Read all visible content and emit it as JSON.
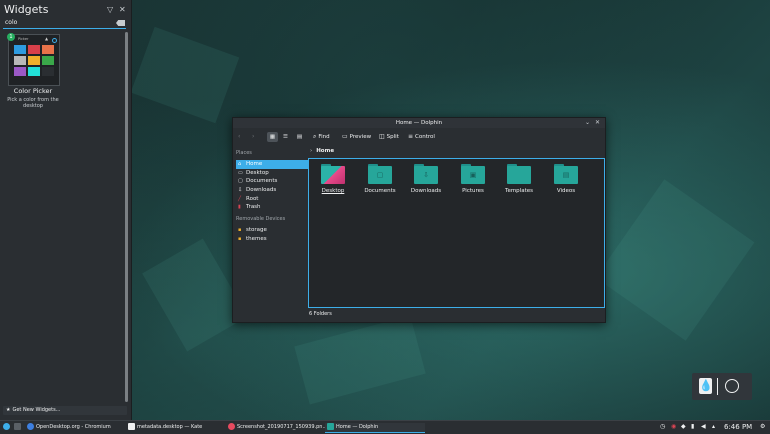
{
  "widgets": {
    "title": "Widgets",
    "search_value": "colo",
    "item": {
      "name": "Color Picker",
      "description": "Pick a color from the desktop",
      "badge": "1",
      "preview_title": "Picker"
    },
    "swatches": [
      "#2d9be0",
      "#d8404a",
      "#e8734a",
      "#b8b8b8",
      "#f0b02a",
      "#3aa84a",
      "#9b59c6",
      "#22e0d8",
      "#2a2e32"
    ],
    "get_new_label": "Get New Widgets..."
  },
  "dolphin": {
    "title": "Home — Dolphin",
    "toolbar": {
      "find": "Find",
      "preview": "Preview",
      "split": "Split",
      "control": "Control"
    },
    "places_header": "Places",
    "places": [
      "Home",
      "Desktop",
      "Documents",
      "Downloads",
      "Root",
      "Trash"
    ],
    "removable_header": "Removable Devices",
    "removable": [
      "storage",
      "themes"
    ],
    "breadcrumb": "Home",
    "folders": [
      "Desktop",
      "Documents",
      "Downloads",
      "Pictures",
      "Templates",
      "Videos"
    ],
    "status": "6 Folders"
  },
  "taskbar": {
    "tasks": [
      "OpenDesktop.org - Chromium",
      "metadata.desktop — Kate",
      "Screenshot_20190717_150939.pn...",
      "Home — Dolphin"
    ],
    "clock": "6:46 PM"
  },
  "colors": {
    "accent": "#3daee9",
    "folder": "#26a69a",
    "panel": "#2a2e32"
  }
}
